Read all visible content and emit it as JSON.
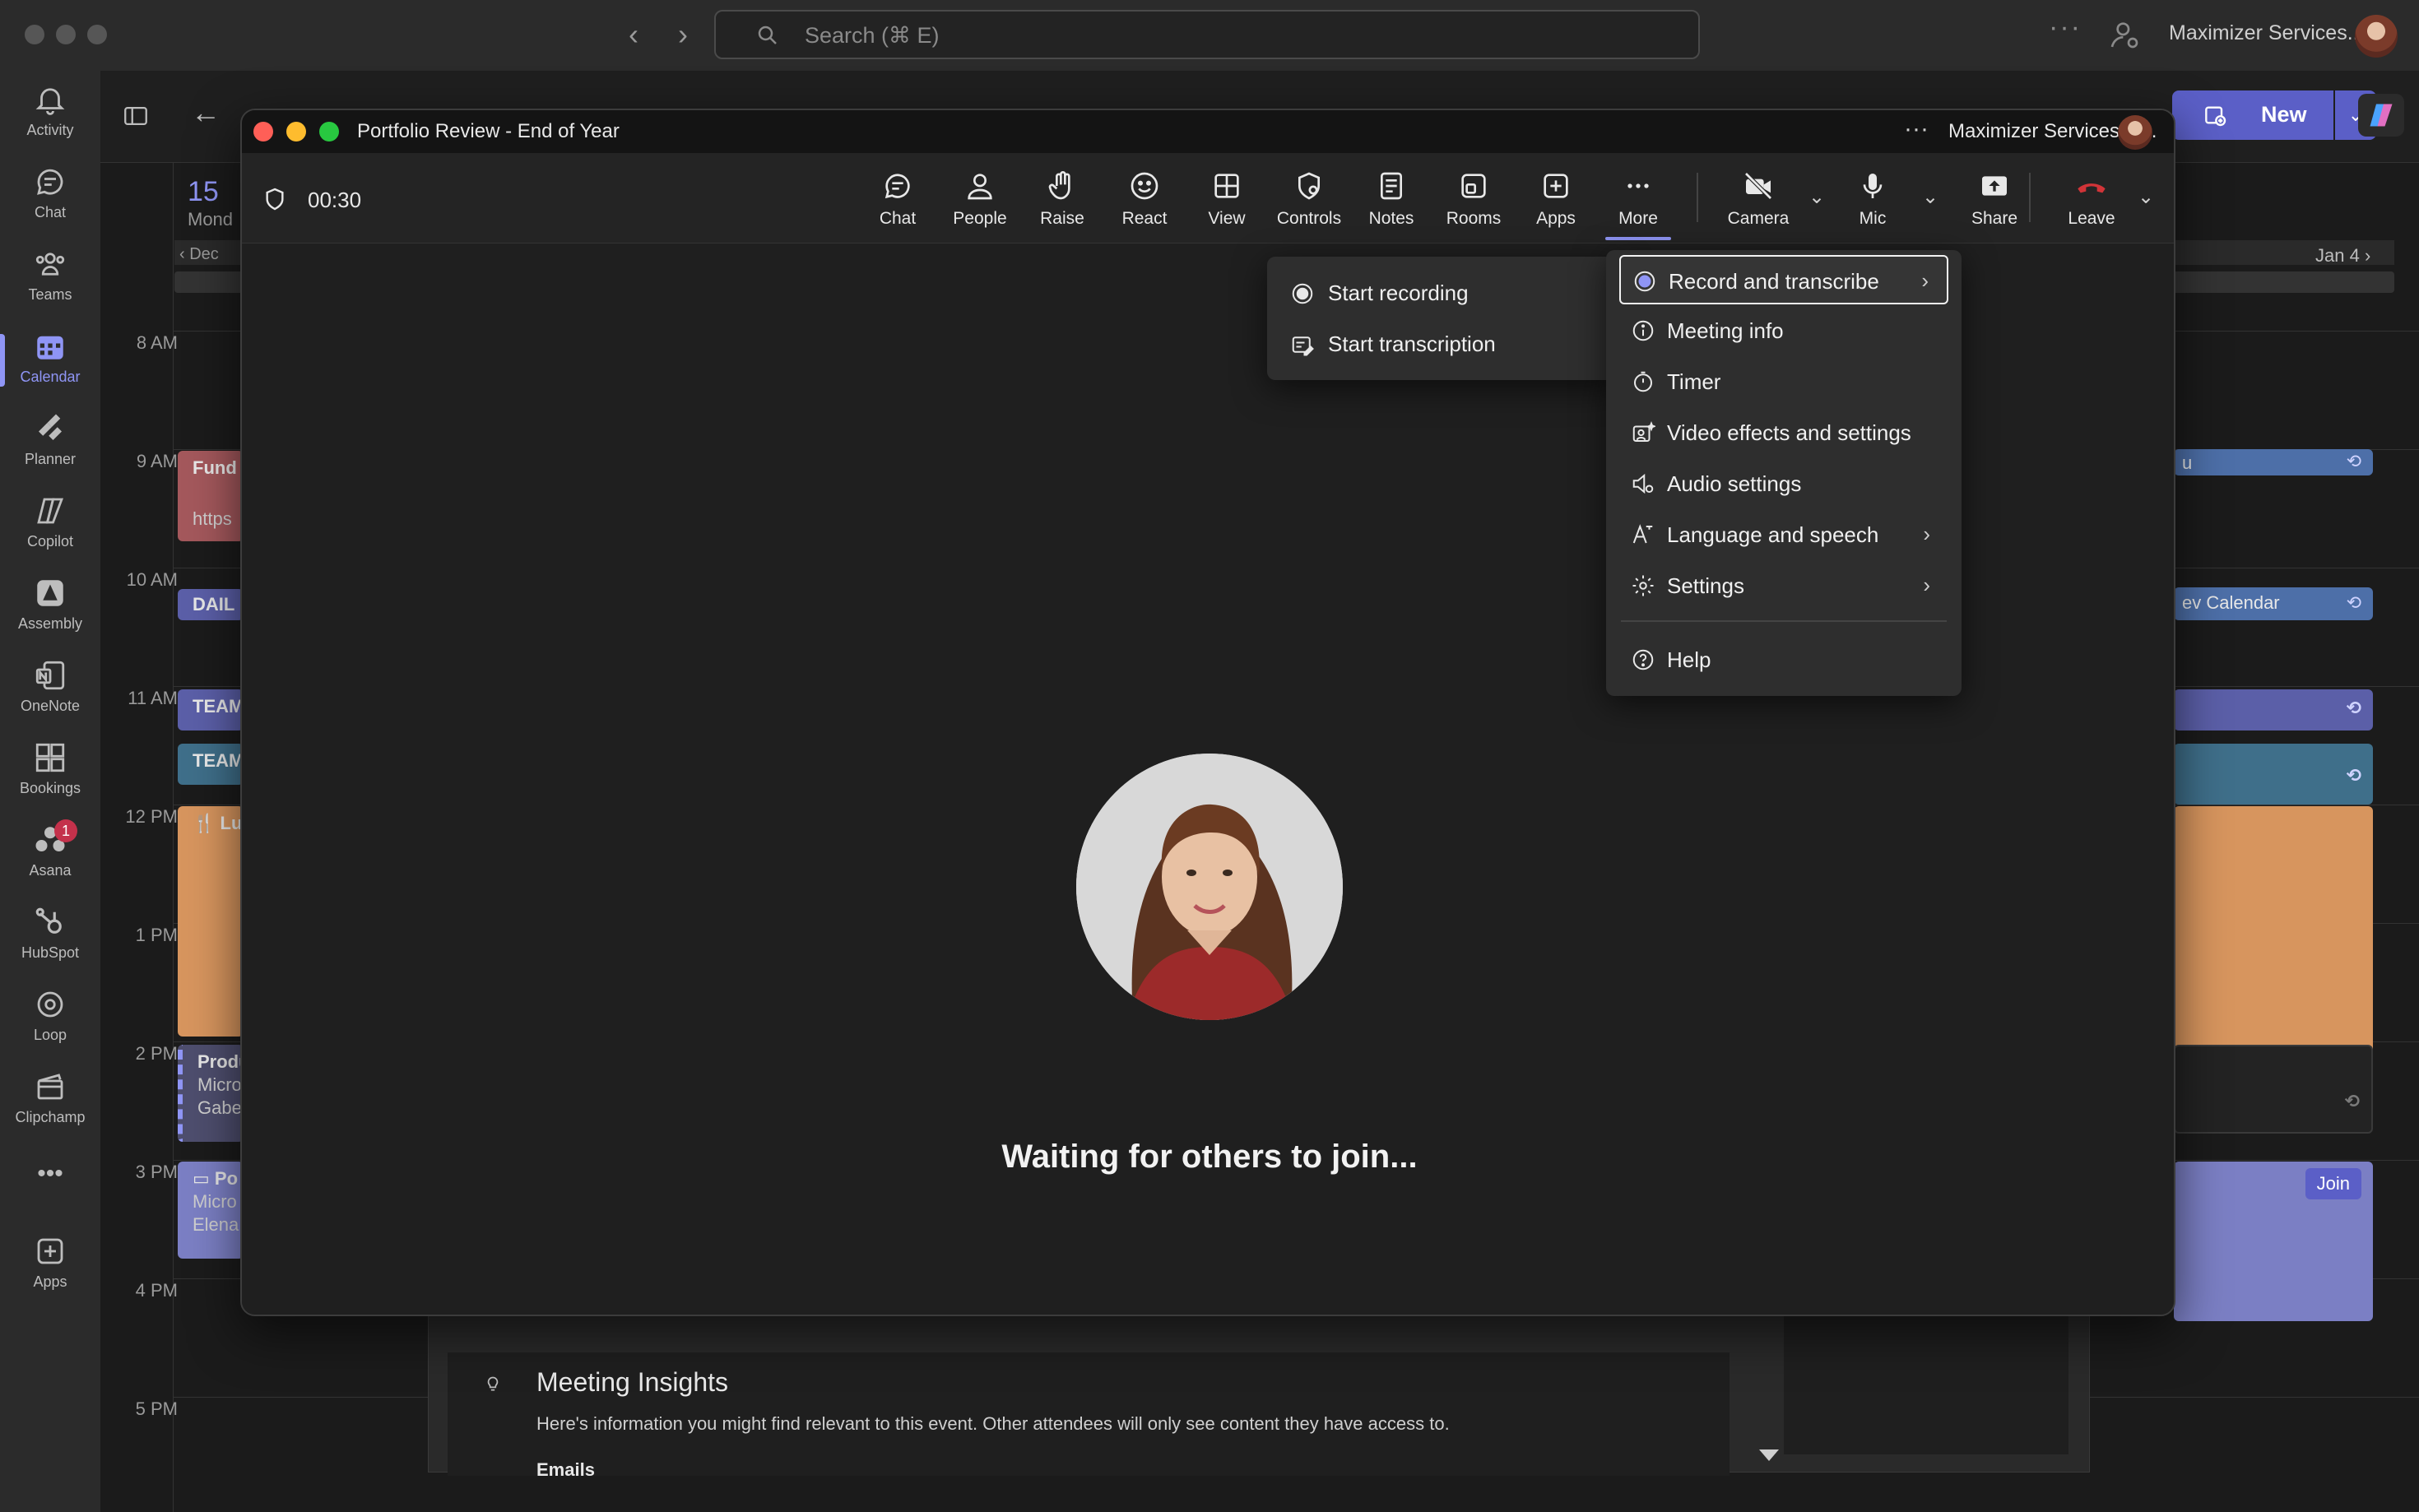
{
  "topbar": {
    "search_placeholder": "Search (⌘ E)",
    "org_name": "Maximizer Services..."
  },
  "rail": {
    "items": [
      {
        "label": "Activity",
        "icon": "bell-icon"
      },
      {
        "label": "Chat",
        "icon": "chat-icon"
      },
      {
        "label": "Teams",
        "icon": "teams-icon"
      },
      {
        "label": "Calendar",
        "icon": "calendar-icon",
        "active": true
      },
      {
        "label": "Planner",
        "icon": "planner-icon"
      },
      {
        "label": "Copilot",
        "icon": "copilot-icon"
      },
      {
        "label": "Assembly",
        "icon": "assembly-icon"
      },
      {
        "label": "OneNote",
        "icon": "onenote-icon"
      },
      {
        "label": "Bookings",
        "icon": "bookings-icon"
      },
      {
        "label": "Asana",
        "icon": "asana-icon",
        "badge": "1"
      },
      {
        "label": "HubSpot",
        "icon": "hubspot-icon"
      },
      {
        "label": "Loop",
        "icon": "loop-icon"
      },
      {
        "label": "Clipchamp",
        "icon": "clipchamp-icon"
      },
      {
        "label": "Apps",
        "icon": "plus-square-icon"
      }
    ],
    "more": "•••"
  },
  "calendar": {
    "day_number": "15",
    "day_name": "Mond",
    "prev_label": "Dec",
    "next_label": "Jan 4",
    "new_label": "New",
    "hours": [
      "8 AM",
      "9 AM",
      "10 AM",
      "11 AM",
      "12 PM",
      "1 PM",
      "2 PM",
      "3 PM",
      "4 PM",
      "5 PM"
    ],
    "events": {
      "fund_title": "Fund",
      "fund_sub": "https",
      "daily": "DAIL",
      "team1": "TEAM",
      "team2": "TEAM",
      "lunch": "Lu",
      "prod_title": "Produ",
      "prod_sub1": "Micro",
      "prod_sub2": "Gabe",
      "po_title": "Po",
      "po_sub1": "Micro",
      "po_sub2": "Elena",
      "right_u": "u",
      "right_dev": "ev Calendar",
      "join": "Join"
    },
    "insights": {
      "title": "Meeting Insights",
      "description": "Here's information you might find relevant to this event. Other attendees will only see content they have access to.",
      "emails_label": "Emails"
    }
  },
  "meeting": {
    "title": "Portfolio Review - End of Year",
    "org_name": "Maximizer Services Inc.",
    "timer": "00:30",
    "waiting": "Waiting for others to join...",
    "toolbar": {
      "chat": "Chat",
      "people": "People",
      "raise": "Raise",
      "react": "React",
      "view": "View",
      "controls": "Controls",
      "notes": "Notes",
      "rooms": "Rooms",
      "apps": "Apps",
      "more": "More",
      "camera": "Camera",
      "mic": "Mic",
      "share": "Share",
      "leave": "Leave"
    }
  },
  "more_menu": {
    "items": [
      {
        "label": "Record and transcribe",
        "icon": "record-icon",
        "submenu": true
      },
      {
        "label": "Meeting info",
        "icon": "info-icon"
      },
      {
        "label": "Timer",
        "icon": "timer-icon"
      },
      {
        "label": "Video effects and settings",
        "icon": "video-effects-icon"
      },
      {
        "label": "Audio settings",
        "icon": "audio-settings-icon"
      },
      {
        "label": "Language and speech",
        "icon": "language-icon",
        "submenu": true
      },
      {
        "label": "Settings",
        "icon": "gear-icon",
        "submenu": true
      },
      {
        "label": "Help",
        "icon": "help-icon"
      }
    ]
  },
  "record_submenu": {
    "items": [
      {
        "label": "Start recording",
        "icon": "record-circle-icon"
      },
      {
        "label": "Start transcription",
        "icon": "transcription-icon"
      }
    ]
  },
  "colors": {
    "accent": "#8f95f5",
    "brand_button": "#5b5fc7",
    "leave_red": "#d13438"
  }
}
